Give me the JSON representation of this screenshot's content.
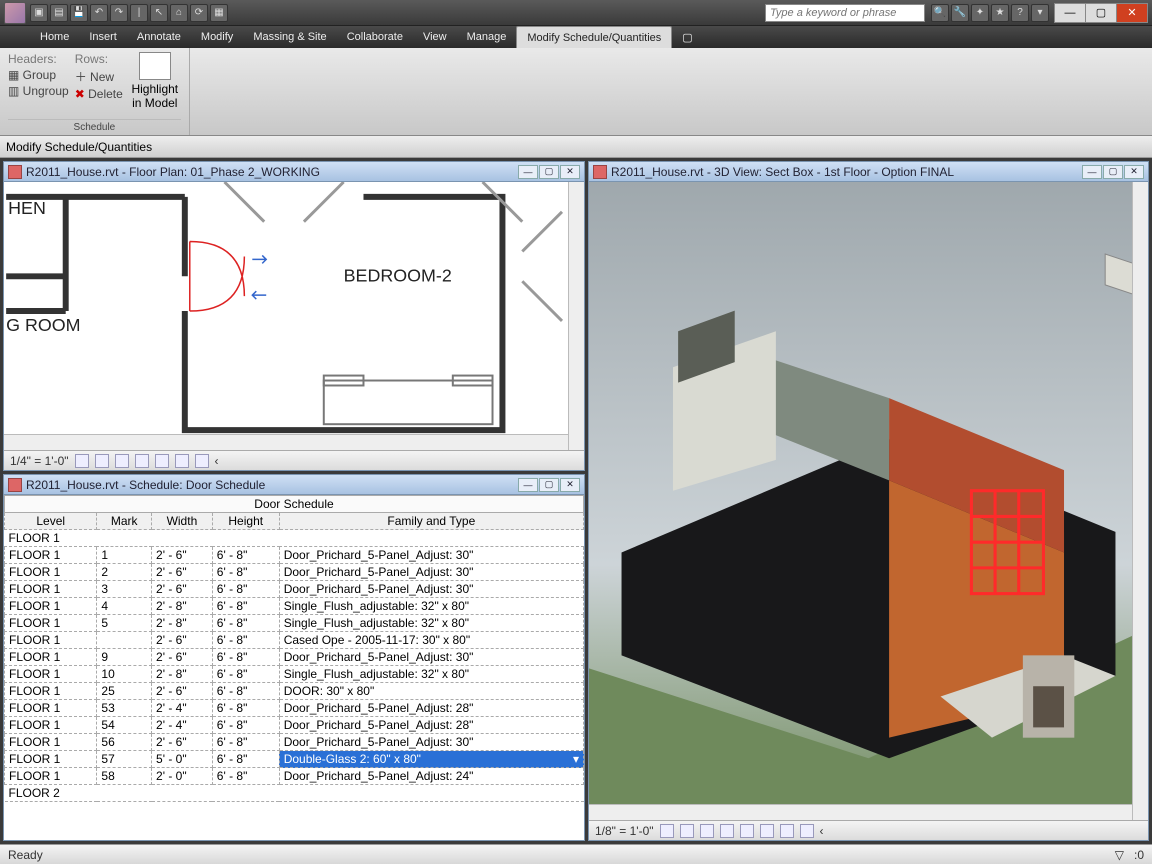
{
  "titlebar": {
    "search_placeholder": "Type a keyword or phrase"
  },
  "menu": {
    "tabs": [
      "Home",
      "Insert",
      "Annotate",
      "Modify",
      "Massing & Site",
      "Collaborate",
      "View",
      "Manage",
      "Modify Schedule/Quantities"
    ],
    "active_index": 8
  },
  "ribbon": {
    "headers_label": "Headers:",
    "headers_group": "Group",
    "headers_ungroup": "Ungroup",
    "rows_label": "Rows:",
    "rows_new": "New",
    "rows_delete": "Delete",
    "highlight": "Highlight\nin Model",
    "panel_label": "Schedule"
  },
  "optionsbar": {
    "text": "Modify Schedule/Quantities"
  },
  "panes": {
    "floorplan_title": "R2011_House.rvt - Floor Plan: 01_Phase 2_WORKING",
    "floorplan_scale": "1/4\" = 1'-0\"",
    "floorplan_room1": "BEDROOM-2",
    "floorplan_room2": "HEN",
    "floorplan_room3": "G ROOM",
    "schedule_title": "R2011_House.rvt - Schedule: Door Schedule",
    "view3d_title": "R2011_House.rvt - 3D View: Sect Box - 1st Floor - Option FINAL",
    "view3d_scale": "1/8\" = 1'-0\""
  },
  "schedule": {
    "title": "Door Schedule",
    "columns": [
      "Level",
      "Mark",
      "Width",
      "Height",
      "Family and Type"
    ],
    "groups": [
      {
        "name": "FLOOR 1",
        "rows": [
          {
            "level": "FLOOR 1",
            "mark": "1",
            "w": "2' - 6\"",
            "h": "6' - 8\"",
            "ft": "Door_Prichard_5-Panel_Adjust: 30\""
          },
          {
            "level": "FLOOR 1",
            "mark": "2",
            "w": "2' - 6\"",
            "h": "6' - 8\"",
            "ft": "Door_Prichard_5-Panel_Adjust: 30\""
          },
          {
            "level": "FLOOR 1",
            "mark": "3",
            "w": "2' - 6\"",
            "h": "6' - 8\"",
            "ft": "Door_Prichard_5-Panel_Adjust: 30\""
          },
          {
            "level": "FLOOR 1",
            "mark": "4",
            "w": "2' - 8\"",
            "h": "6' - 8\"",
            "ft": "Single_Flush_adjustable: 32\" x 80\""
          },
          {
            "level": "FLOOR 1",
            "mark": "5",
            "w": "2' - 8\"",
            "h": "6' - 8\"",
            "ft": "Single_Flush_adjustable: 32\" x 80\""
          },
          {
            "level": "FLOOR 1",
            "mark": "",
            "w": "2' - 6\"",
            "h": "6' - 8\"",
            "ft": "Cased Ope - 2005-11-17: 30\" x 80\""
          },
          {
            "level": "FLOOR 1",
            "mark": "9",
            "w": "2' - 6\"",
            "h": "6' - 8\"",
            "ft": "Door_Prichard_5-Panel_Adjust: 30\""
          },
          {
            "level": "FLOOR 1",
            "mark": "10",
            "w": "2' - 8\"",
            "h": "6' - 8\"",
            "ft": "Single_Flush_adjustable: 32\" x 80\""
          },
          {
            "level": "FLOOR 1",
            "mark": "25",
            "w": "2' - 6\"",
            "h": "6' - 8\"",
            "ft": "DOOR: 30\" x 80\""
          },
          {
            "level": "FLOOR 1",
            "mark": "53",
            "w": "2' - 4\"",
            "h": "6' - 8\"",
            "ft": "Door_Prichard_5-Panel_Adjust: 28\""
          },
          {
            "level": "FLOOR 1",
            "mark": "54",
            "w": "2' - 4\"",
            "h": "6' - 8\"",
            "ft": "Door_Prichard_5-Panel_Adjust: 28\""
          },
          {
            "level": "FLOOR 1",
            "mark": "56",
            "w": "2' - 6\"",
            "h": "6' - 8\"",
            "ft": "Door_Prichard_5-Panel_Adjust: 30\""
          },
          {
            "level": "FLOOR 1",
            "mark": "57",
            "w": "5' - 0\"",
            "h": "6' - 8\"",
            "ft": "Double-Glass 2: 60\" x 80\"",
            "selected": true
          },
          {
            "level": "FLOOR 1",
            "mark": "58",
            "w": "2' - 0\"",
            "h": "6' - 8\"",
            "ft": "Door_Prichard_5-Panel_Adjust: 24\""
          }
        ]
      },
      {
        "name": "FLOOR 2",
        "rows": []
      }
    ]
  },
  "status": {
    "left": "Ready",
    "filter_icon": "▽",
    "zero": ":0"
  }
}
